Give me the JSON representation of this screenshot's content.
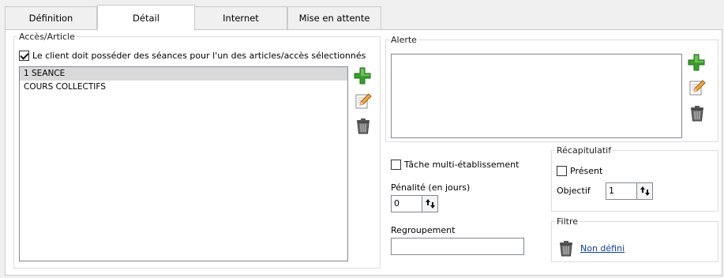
{
  "tabs": [
    {
      "label": "Définition"
    },
    {
      "label": "Détail"
    },
    {
      "label": "Internet"
    },
    {
      "label": "Mise en attente"
    }
  ],
  "acces": {
    "legend": "Accès/Article",
    "checkbox_label": "Le client doit posséder des séances pour l'un des articles/accès sélectionnés",
    "checkbox_checked": true,
    "items": [
      "1 SEANCE",
      "COURS COLLECTIFS"
    ],
    "selected_index": 0
  },
  "alerte": {
    "legend": "Alerte",
    "text": ""
  },
  "options": {
    "multi_label": "Tâche multi-établissement",
    "multi_checked": false,
    "penalite_label": "Pénalité (en jours)",
    "penalite_value": "0",
    "regroupement_label": "Regroupement",
    "regroupement_value": ""
  },
  "recap": {
    "legend": "Récapitulatif",
    "present_label": "Présent",
    "present_checked": false,
    "objectif_label": "Objectif",
    "objectif_value": "1"
  },
  "filtre": {
    "legend": "Filtre",
    "link": "Non défini"
  },
  "icons": {
    "add": "add-icon",
    "edit": "edit-icon",
    "delete": "trash-icon",
    "spinner": "spinner-arrows-icon"
  },
  "colors": {
    "link": "#0b3e9c",
    "add_green": "#3ca42a",
    "selection": "#d9d9d9"
  }
}
